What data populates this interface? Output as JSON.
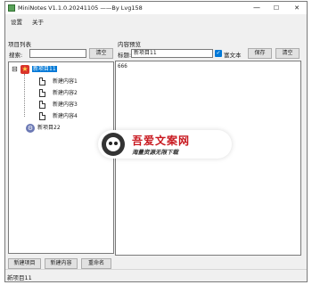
{
  "window": {
    "title": "MiniNotes V1.1.0.20241105 ——By Lvg158",
    "minimize_glyph": "—",
    "maximize_glyph": "☐",
    "close_glyph": "✕"
  },
  "menu": {
    "items": [
      "设置",
      "关于"
    ]
  },
  "left_pane": {
    "label": "项目列表",
    "search_label": "搜索:",
    "search_value": "",
    "clear_label": "清空",
    "tree": {
      "expander": "⊟",
      "root": {
        "label": "新项目11",
        "children": [
          "新建内容1",
          "新建内容2",
          "新建内容3",
          "新建内容4"
        ]
      },
      "second_root": {
        "label": "新项目22"
      }
    },
    "buttons": {
      "new_project": "新建项目",
      "new_content": "新建内容",
      "rename": "重命名"
    }
  },
  "right_pane": {
    "label": "内容预览",
    "title_label": "标题:",
    "title_value": "新项目11",
    "rich_text_label": "富文本",
    "rich_text_checked": true,
    "save_label": "保存",
    "clear_label": "清空",
    "editor_text": "666"
  },
  "status": {
    "text": "新项目11"
  },
  "watermark": {
    "title": "吾爱文案网",
    "subtitle": "海量资源无限下载"
  },
  "colors": {
    "selection": "#0078d7",
    "watermark_red": "#c8171e"
  }
}
